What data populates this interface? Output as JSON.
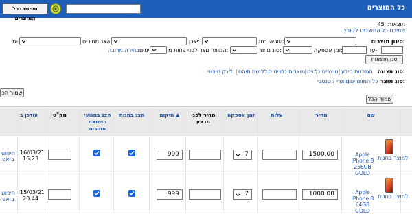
{
  "header": {
    "title": "כל המוצרים",
    "search_button": "חיפוש בכל המוצרים",
    "search_value": ""
  },
  "results": {
    "count_label": "תוצאות: 45",
    "save_link": "שמירת כל המוצרים לקובץ"
  },
  "filters": {
    "title": "סינון מוצרים:",
    "main_label": "הצג:",
    "category_label": "קטגוריה:",
    "tag_label": "תג:",
    "manufacturer_label": "יצרן:",
    "prices_label": "מחירים:",
    "from_label": "מ-",
    "to_label": "עד-",
    "supply_label": "זמן אספקה:",
    "product_type_label": "סוג מוצר:",
    "stored_label": "המוצר נוצר לפני פחות מ:",
    "days_label": "ימים",
    "quick_select": "בחירה מרובה",
    "filter_button": "סנן תוצאות"
  },
  "display": {
    "label": "סוג תצוגה:",
    "options": [
      "הגנכנות מידע",
      "מוצרים נלווים",
      "מוצרים נלווים כולל שמותיהם",
      "לינק חיצוני"
    ]
  },
  "product_type": {
    "label": "סוג מוצר:",
    "options": [
      "כל המוצרים",
      "מוצרי קטנטבי"
    ]
  },
  "buttons": {
    "save_all": "שמור הכל",
    "save_changes": "שמור הכ"
  },
  "table": {
    "headers": {
      "name": "שם",
      "price": "מחיר",
      "cost": "עלות",
      "supply": "זמן אספקה",
      "price_before": "מחיר לפני מבצע",
      "position": "מיקום ▲",
      "show_in_store": "הצג בחנות",
      "show_compare": "הצג במנועי השוואת מחירים",
      "sku": "מק\"ט",
      "updated": "עודכן ב"
    },
    "rows": [
      {
        "name": "Apple iPhone 8 256GB GOLD",
        "store_link": "למוצר בחנות",
        "price": "1500.00",
        "cost": "",
        "supply": "7",
        "price_before": "",
        "position": "999",
        "show_in_store": true,
        "show_compare": true,
        "sku": "",
        "updated_date": "16/03/21",
        "updated_time": "16:23",
        "search_link": "חיפוש בזאפ"
      },
      {
        "name": "Apple iPhone 8 64GB GOLD",
        "store_link": "למוצר בחנות",
        "price": "1000.00",
        "cost": "",
        "supply": "7",
        "price_before": "",
        "position": "999",
        "show_in_store": true,
        "show_compare": true,
        "sku": "",
        "updated_date": "15/03/21",
        "updated_time": "20:44",
        "search_link": "חיפוש בזאפ"
      }
    ]
  },
  "colors": {
    "header_bg": "#1d5fb8",
    "link": "#1a4fa3",
    "checkbox": "#1565e0"
  }
}
